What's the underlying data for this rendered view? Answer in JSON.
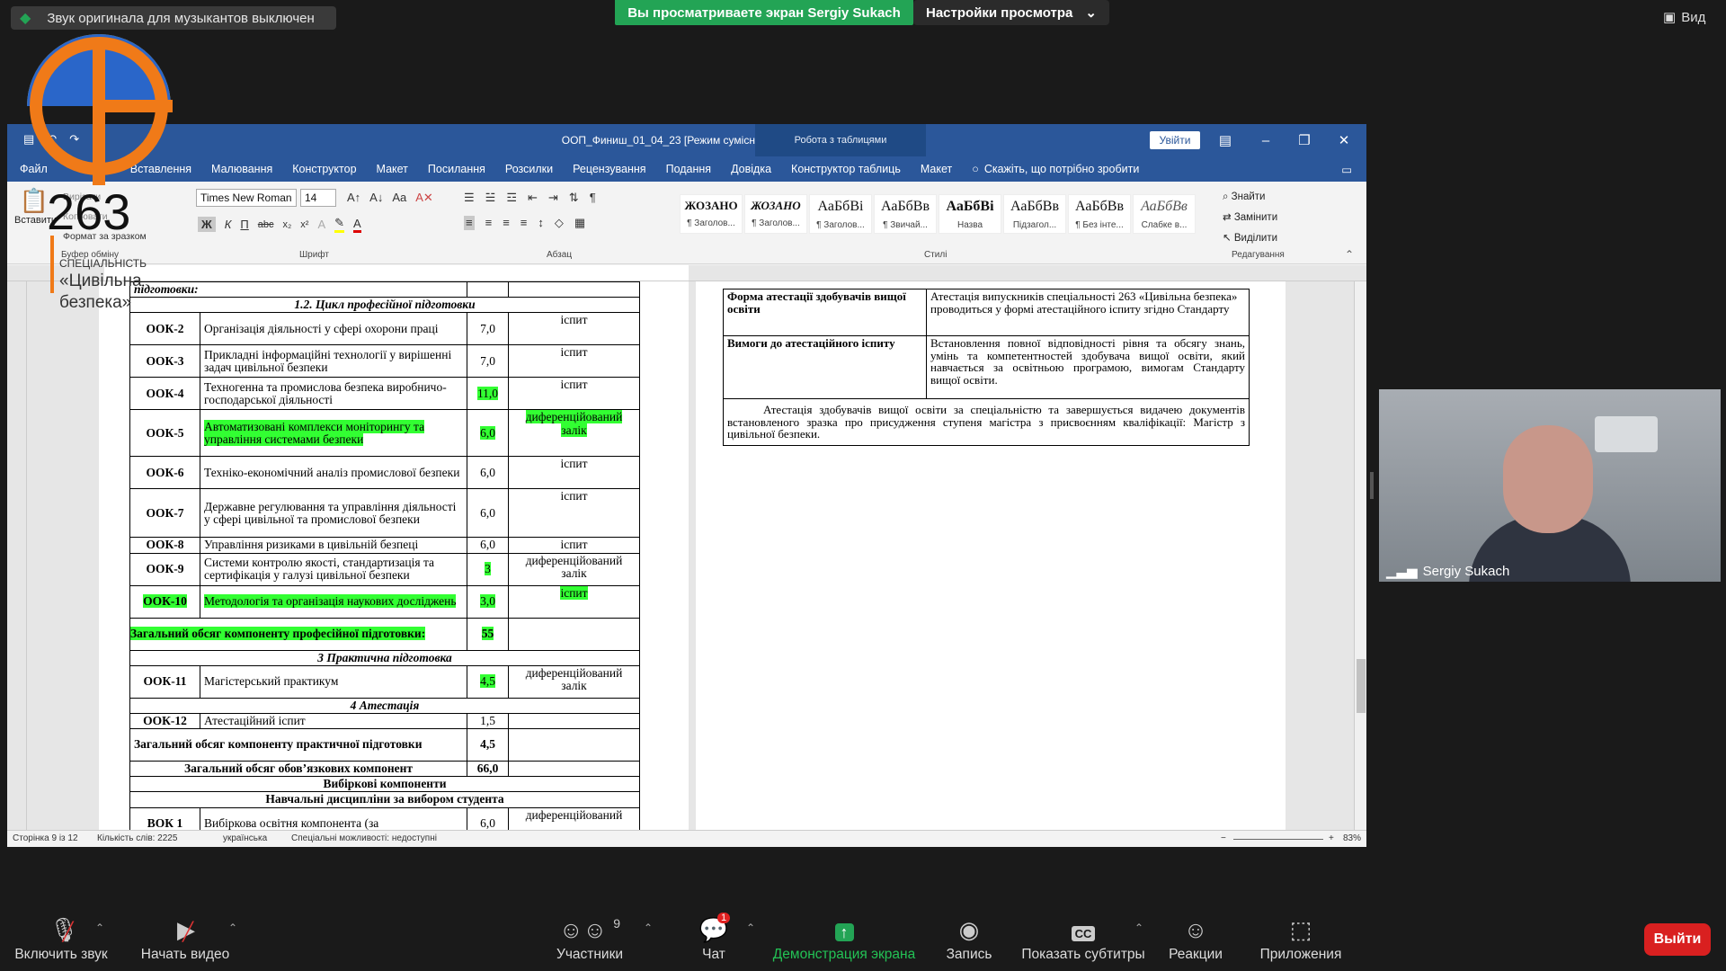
{
  "zoom": {
    "audio_notice": "Звук оригинала для музыкантов выключен",
    "sharing_banner": "Вы просматриваете экран Sergiy Sukach",
    "view_settings": "Настройки просмотра",
    "view_label": "Вид",
    "participant_name": "Sergiy Sukach",
    "controls": {
      "unmute": "Включить звук",
      "start_video": "Начать видео",
      "participants": "Участники",
      "participants_count": "9",
      "chat": "Чат",
      "chat_badge": "1",
      "share": "Демонстрация экрана",
      "record": "Запись",
      "captions": "Показать субтитры",
      "reactions": "Реакции",
      "apps": "Приложения",
      "leave": "Выйти"
    }
  },
  "logo": {
    "number": "263",
    "line1": "СПЕЦІАЛЬНІСТЬ",
    "line2": "«Цивільна",
    "line3": "безпека»"
  },
  "word": {
    "title": "ООП_Финиш_01_04_23 [Режим сумісності]  -  Word",
    "table_tools": "Робота з таблицями",
    "sign_in": "Увійти",
    "tabs": [
      "Файл",
      "Вставлення",
      "Малювання",
      "Конструктор",
      "Макет",
      "Посилання",
      "Розсилки",
      "Рецензування",
      "Подання",
      "Довідка",
      "Конструктор таблиць",
      "Макет"
    ],
    "tell_me": "Скажіть, що потрібно зробити",
    "ribbon": {
      "paste": "Вставити",
      "cut": "Вирізати",
      "copy": "Копіювати",
      "format_painter": "Формат за зразком",
      "clipboard": "Буфер обміну",
      "font_name": "Times New Roman",
      "font_size": "14",
      "font_group": "Шрифт",
      "paragraph_group": "Абзац",
      "styles_group": "Стилі",
      "editing_group": "Редагування",
      "find": "Знайти",
      "replace": "Замінити",
      "select": "Виділити",
      "styles": [
        {
          "sample": "ЖОЗАНО",
          "name": "¶ Заголов..."
        },
        {
          "sample": "ЖОЗАНО",
          "name": "¶ Заголов..."
        },
        {
          "sample": "АаБбВі",
          "name": "¶ Заголов..."
        },
        {
          "sample": "АаБбВв",
          "name": "¶ Звичай..."
        },
        {
          "sample": "АаБбВі",
          "name": "Назва"
        },
        {
          "sample": "АаБбВв",
          "name": "Підзагол..."
        },
        {
          "sample": "АаБбВв",
          "name": "¶ Без інте..."
        },
        {
          "sample": "АаБбВв",
          "name": "Слабке в..."
        }
      ]
    },
    "status": {
      "page": "Сторінка 9 із 12",
      "words": "Кількість слів: 2225",
      "language": "українська",
      "accessibility": "Спеціальні можливості: недоступні",
      "zoom": "83%"
    },
    "left_table": {
      "top_row": "підготовки:",
      "section_1": "1.2. Цикл професійної підготовки",
      "rows_1": [
        {
          "code": "ООК-2",
          "name": "Організація діяльності у сфері охорони праці",
          "credits": "7,0",
          "form": "іспит",
          "hl": false
        },
        {
          "code": "ООК-3",
          "name": "Прикладні інформаційні технології у вирішенні задач цивільної безпеки",
          "credits": "7,0",
          "form": "іспит",
          "hl": false
        },
        {
          "code": "ООК-4",
          "name": "Техногенна та промислова безпека виробничо-господарської діяльності",
          "credits": "11,0",
          "form": "іспит",
          "hl": false
        },
        {
          "code": "ООК-5",
          "name": "Автоматизовані комплекси моніторингу та управління системами безпеки",
          "credits": "6,0",
          "form": "диференційований залік",
          "hl": true
        },
        {
          "code": "ООК-6",
          "name": "Техніко-економічний аналіз промислової безпеки",
          "credits": "6,0",
          "form": "іспит",
          "hl": false
        },
        {
          "code": "ООК-7",
          "name": "Державне регулювання та управління діяльності у сфері цивільної та промислової безпеки",
          "credits": "6,0",
          "form": "іспит",
          "hl": false
        },
        {
          "code": "ООК-8",
          "name": "Управління ризиками в цивільній безпеці",
          "credits": "6,0",
          "form": "іспит",
          "hl": false
        },
        {
          "code": "ООК-9",
          "name": "Системи контролю якості, стандартизація та сертифікація у галузі цивільної безпеки",
          "credits": "3",
          "form": "диференційований залік",
          "hl": false
        },
        {
          "code": "ООК-10",
          "name": "Методологія та організація наукових досліджень",
          "credits": "3,0",
          "form": "іспит",
          "hl": true
        }
      ],
      "total_prof_label": "Загальний обсяг компоненту професійної підготовки:",
      "total_prof": "55",
      "section_3": "3 Практична підготовка",
      "ook11": {
        "code": "ООК-11",
        "name": "Магістерський практикум",
        "credits": "4,5",
        "form": "диференційований залік"
      },
      "section_4": "4 Атестація",
      "ook12": {
        "code": "ООК-12",
        "name": "Атестаційний іспит",
        "credits": "1,5",
        "form": ""
      },
      "total_prac_label": "Загальний обсяг компоненту практичної підготовки",
      "total_prac": "4,5",
      "total_mand_label": "Загальний обсяг обов’язкових компонент",
      "total_mand": "66,0",
      "elective": "Вибіркові компоненти",
      "elective_sub": "Навчальні дисципліни за вибором студента",
      "vk1": {
        "code": "ВОК 1",
        "name": "Вибіркова освітня компонента (за",
        "credits": "6,0",
        "form": "диференційований"
      }
    },
    "right_table": {
      "row1_label": "Форма атестації здобувачів вищої освіти",
      "row1_text": "Атестація випускників спеціальності 263 «Цивільна безпека» проводиться у формі атестаційного іспиту згідно Стандарту",
      "row2_label": "Вимоги до атестаційного іспиту",
      "row2_text": "Встановлення повної відповідності рівня та обсягу знань, умінь та компетентностей здобувача вищої освіти, який навчається за освітньою програмою, вимогам Стандарту вищої освіти.",
      "row3_text": "Атестація здобувачів вищої освіти за спеціальністю та завершується видачею документів встановленого зразка про присудження ступеня магістра з присвоєнням кваліфікації: Магістр з цивільної безпеки."
    }
  },
  "colors": {
    "accent_green": "#23a455",
    "word_blue": "#2b579a",
    "highlight": "#32ff32",
    "leave_red": "#d92020"
  }
}
